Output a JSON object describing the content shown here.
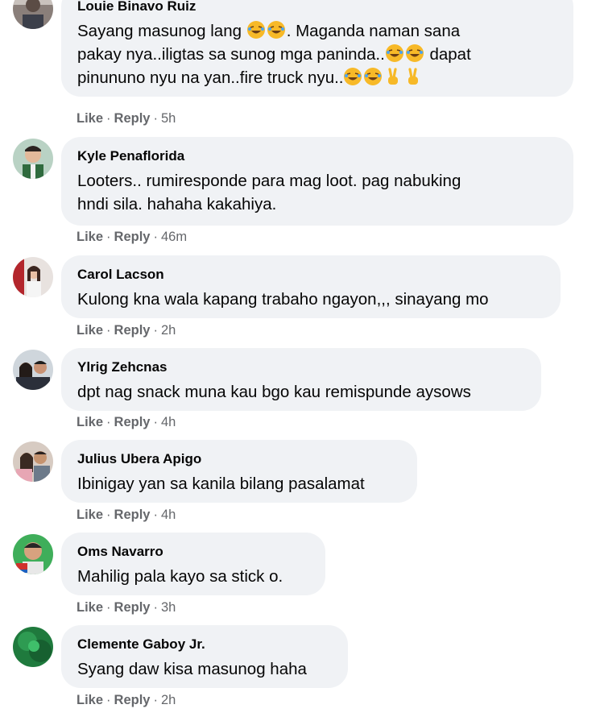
{
  "actions": {
    "like": "Like",
    "reply": "Reply",
    "separator": "·"
  },
  "comments": [
    {
      "author": "Louie Binavo Ruiz",
      "lines": [
        "Sayang masunog lang",
        ". Maganda naman sana",
        "pakay nya..iligtas sa sunog mga paninda..",
        " dapat",
        "pinununo nyu na yan..fire truck nyu.."
      ],
      "time": "5h",
      "avatar_icon": "profile-photo-icon"
    },
    {
      "author": "Kyle Penaflorida",
      "lines": [
        "Looters.. rumiresponde para mag loot. pag nabuking",
        "hndi sila. hahaha kakahiya."
      ],
      "time": "46m",
      "avatar_icon": "profile-photo-icon"
    },
    {
      "author": "Carol Lacson",
      "lines": [
        "Kulong kna wala kapang trabaho ngayon,,, sinayang mo"
      ],
      "time": "2h",
      "avatar_icon": "profile-photo-icon"
    },
    {
      "author": "Ylrig Zehcnas",
      "lines": [
        "dpt nag snack muna kau bgo kau remispunde aysows"
      ],
      "time": "4h",
      "avatar_icon": "profile-photo-icon"
    },
    {
      "author": "Julius Ubera Apigo",
      "lines": [
        "Ibinigay yan sa kanila bilang pasalamat"
      ],
      "time": "4h",
      "avatar_icon": "profile-photo-icon"
    },
    {
      "author": "Oms Navarro",
      "lines": [
        "Mahilig pala kayo sa stick o."
      ],
      "time": "3h",
      "avatar_icon": "profile-photo-icon"
    },
    {
      "author": "Clemente Gaboy Jr.",
      "lines": [
        "Syang daw kisa masunog haha"
      ],
      "time": "2h",
      "avatar_icon": "profile-photo-icon"
    }
  ],
  "emoji": {
    "laugh": "rolling-on-floor-laughing-emoji",
    "peace": "victory-hand-emoji"
  },
  "colors": {
    "bubble": "#f0f2f5",
    "text": "#050505",
    "meta": "#65676b"
  }
}
